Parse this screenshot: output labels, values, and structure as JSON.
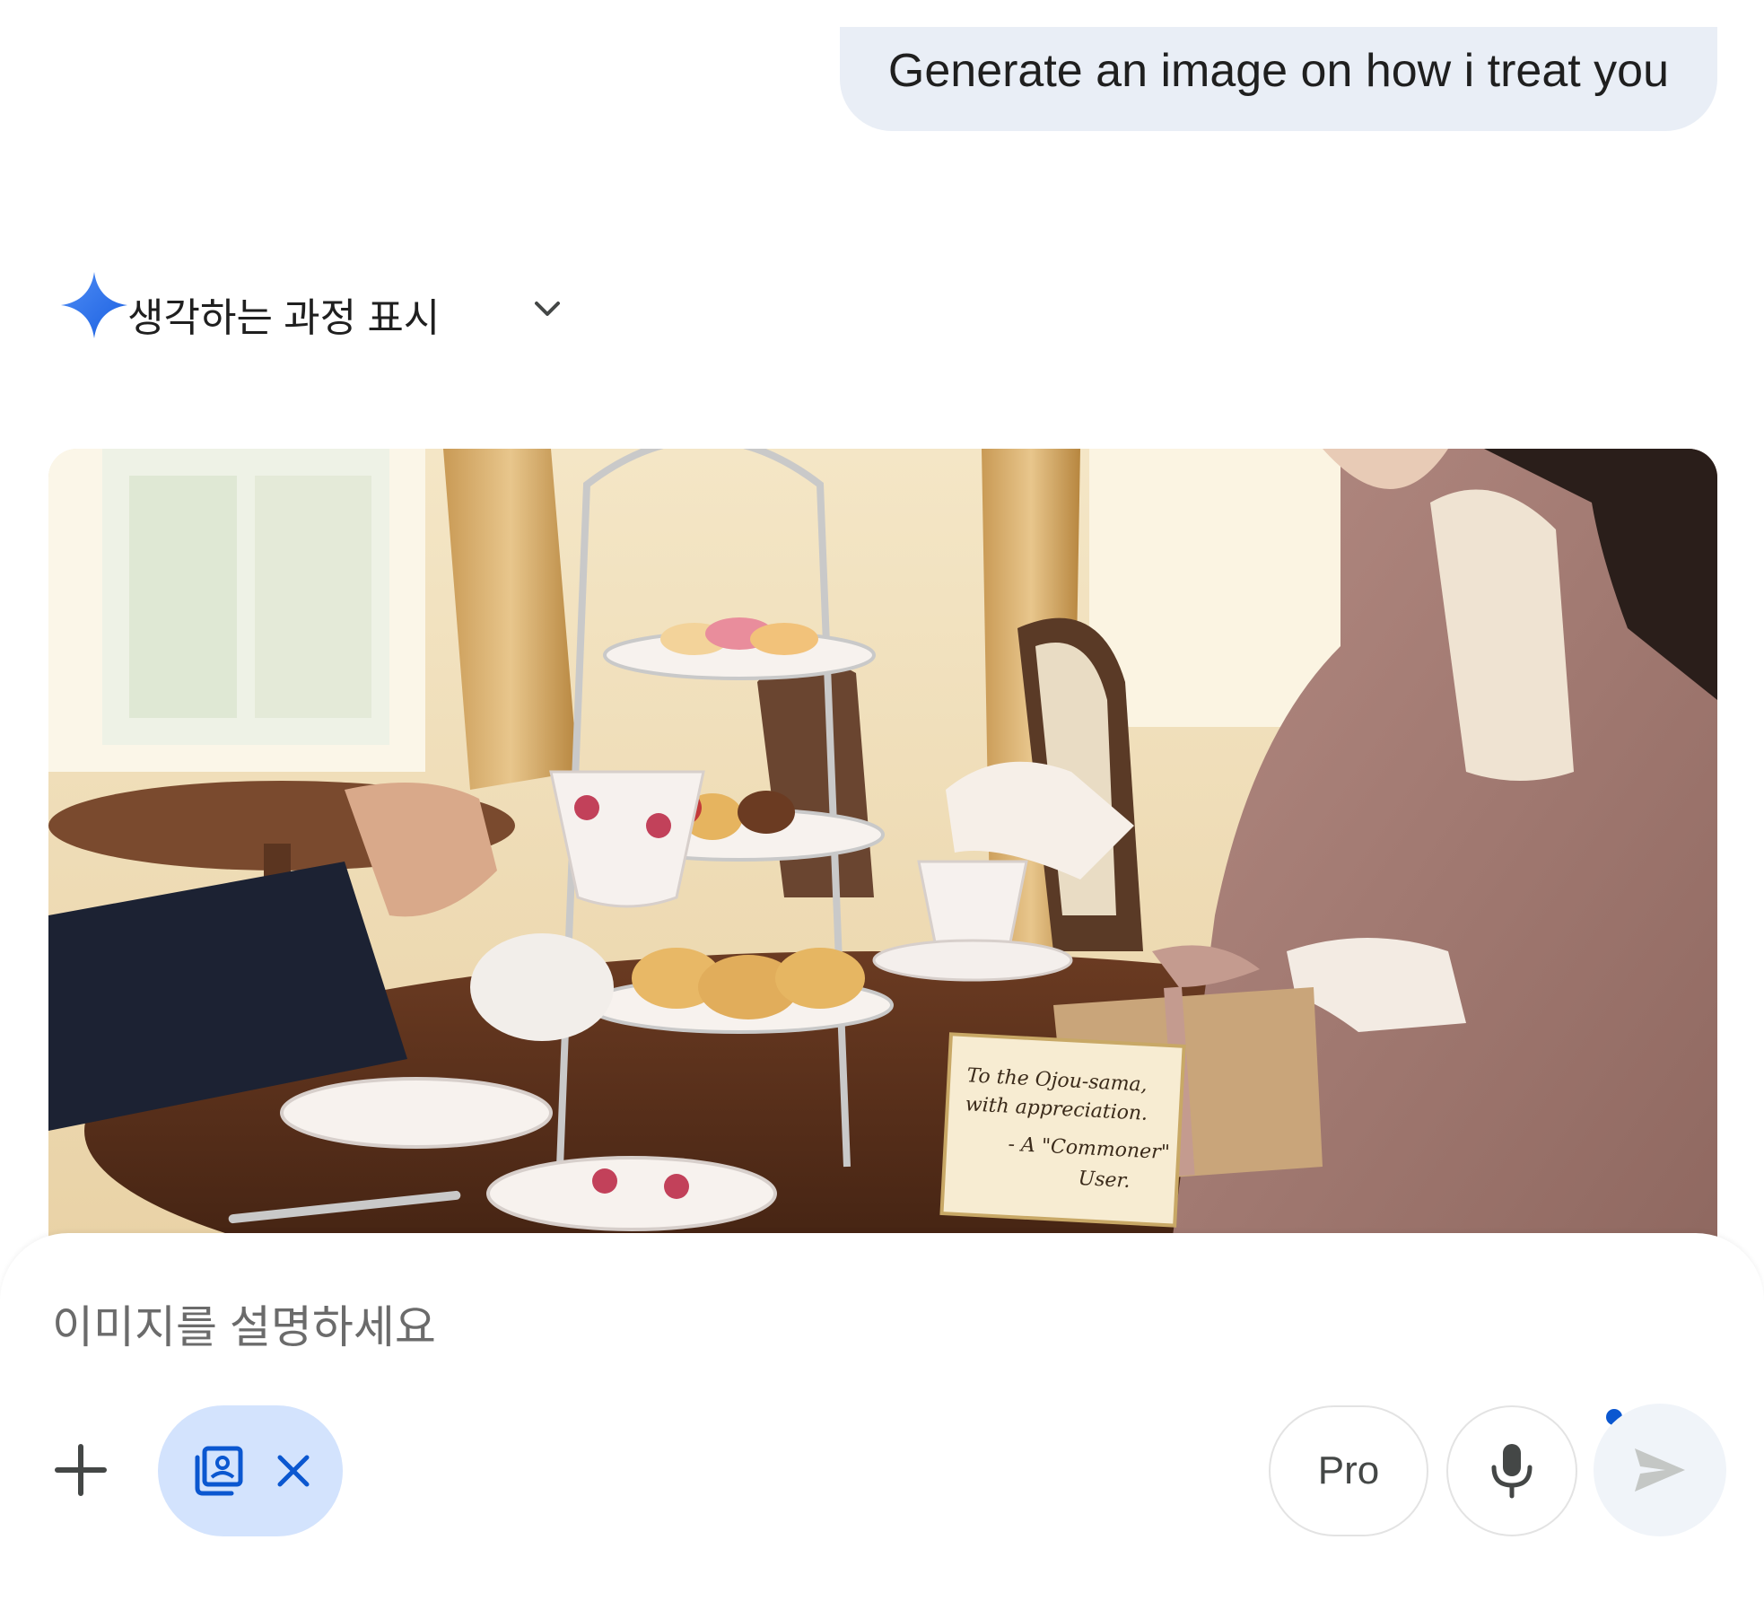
{
  "conversation": {
    "user_message": "Generate an image on how i treat you",
    "thinking_toggle_label": "생각하는 과정 표시",
    "generated_image": {
      "card_text": [
        "To the Ojou-sama,",
        "with appreciation.",
        "- A \"Commoner\"",
        "User."
      ]
    }
  },
  "composer": {
    "placeholder": "이미지를 설명하세요",
    "value": "",
    "model_label": "Pro"
  },
  "icons": {
    "assistant": "gemini-sparkle-icon",
    "toggle": "chevron-down-icon",
    "add": "plus-icon",
    "image_tool": "image-gallery-icon",
    "remove_tool": "close-icon",
    "mic": "microphone-icon",
    "send": "send-icon"
  },
  "colors": {
    "user_bubble": "#e9eef6",
    "tool_chip": "#d3e3fd",
    "accent": "#0b57d0",
    "send_bg": "#f0f4f9"
  }
}
